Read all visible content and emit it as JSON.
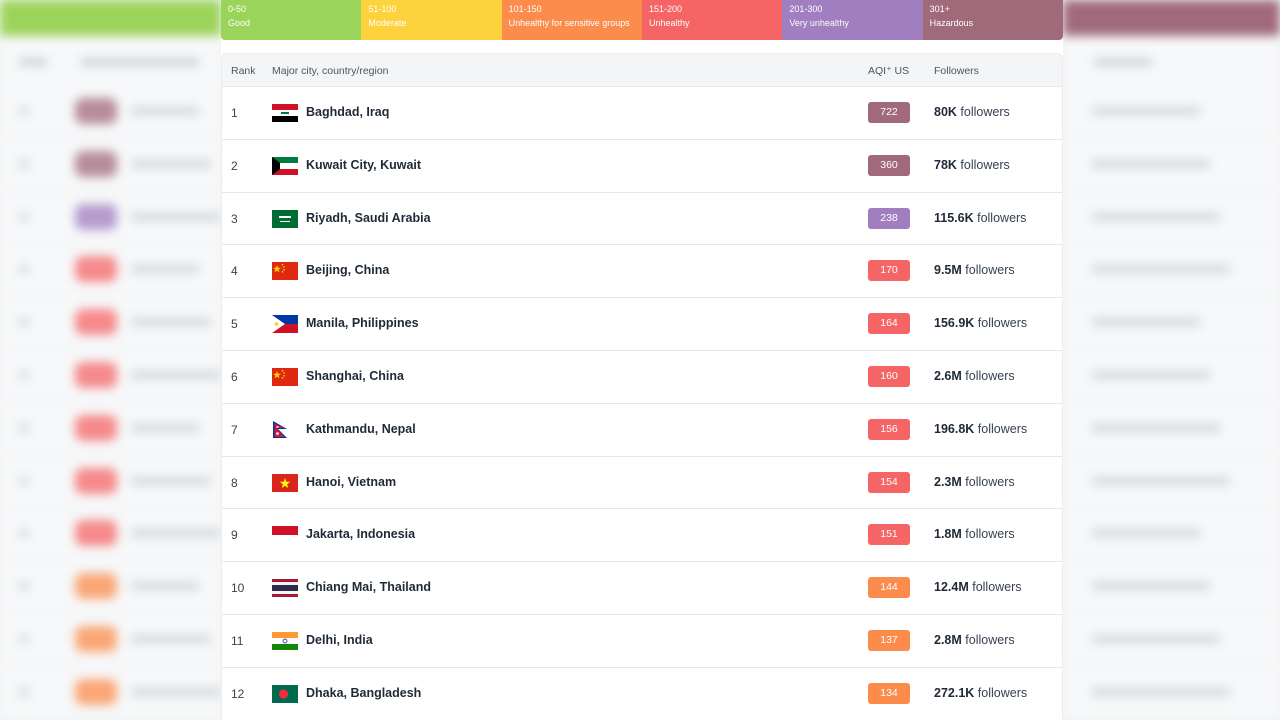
{
  "legend": [
    {
      "range": "0-50",
      "label": "Good",
      "color": "#9bd45a"
    },
    {
      "range": "51-100",
      "label": "Moderate",
      "color": "#fdd23c"
    },
    {
      "range": "101-150",
      "label": "Unhealthy for sensitive groups",
      "color": "#fb8c4b"
    },
    {
      "range": "151-200",
      "label": "Unhealthy",
      "color": "#f66566"
    },
    {
      "range": "201-300",
      "label": "Very unhealthy",
      "color": "#a07ebf"
    },
    {
      "range": "301+",
      "label": "Hazardous",
      "color": "#a06a7b"
    }
  ],
  "table": {
    "headers": {
      "rank": "Rank",
      "city": "Major city, country/region",
      "aqi": "AQI⁺ US",
      "followers": "Followers"
    },
    "followers_suffix": "followers",
    "rows": [
      {
        "rank": "1",
        "city": "Baghdad, Iraq",
        "aqi": "722",
        "followers": "80K",
        "flag": "iraq-flag-icon",
        "color": "#a06a7b"
      },
      {
        "rank": "2",
        "city": "Kuwait City, Kuwait",
        "aqi": "360",
        "followers": "78K",
        "flag": "kuwait-flag-icon",
        "color": "#a06a7b"
      },
      {
        "rank": "3",
        "city": "Riyadh, Saudi Arabia",
        "aqi": "238",
        "followers": "115.6K",
        "flag": "saudi-arabia-flag-icon",
        "color": "#a07ebf"
      },
      {
        "rank": "4",
        "city": "Beijing, China",
        "aqi": "170",
        "followers": "9.5M",
        "flag": "china-flag-icon",
        "color": "#f66566"
      },
      {
        "rank": "5",
        "city": "Manila, Philippines",
        "aqi": "164",
        "followers": "156.9K",
        "flag": "philippines-flag-icon",
        "color": "#f66566"
      },
      {
        "rank": "6",
        "city": "Shanghai, China",
        "aqi": "160",
        "followers": "2.6M",
        "flag": "china-flag-icon",
        "color": "#f66566"
      },
      {
        "rank": "7",
        "city": "Kathmandu, Nepal",
        "aqi": "156",
        "followers": "196.8K",
        "flag": "nepal-flag-icon",
        "color": "#f66566"
      },
      {
        "rank": "8",
        "city": "Hanoi, Vietnam",
        "aqi": "154",
        "followers": "2.3M",
        "flag": "vietnam-flag-icon",
        "color": "#f66566"
      },
      {
        "rank": "9",
        "city": "Jakarta, Indonesia",
        "aqi": "151",
        "followers": "1.8M",
        "flag": "indonesia-flag-icon",
        "color": "#f66566"
      },
      {
        "rank": "10",
        "city": "Chiang Mai, Thailand",
        "aqi": "144",
        "followers": "12.4M",
        "flag": "thailand-flag-icon",
        "color": "#fb8c4b"
      },
      {
        "rank": "11",
        "city": "Delhi, India",
        "aqi": "137",
        "followers": "2.8M",
        "flag": "india-flag-icon",
        "color": "#fb8c4b"
      },
      {
        "rank": "12",
        "city": "Dhaka, Bangladesh",
        "aqi": "134",
        "followers": "272.1K",
        "flag": "bangladesh-flag-icon",
        "color": "#fb8c4b"
      }
    ]
  }
}
